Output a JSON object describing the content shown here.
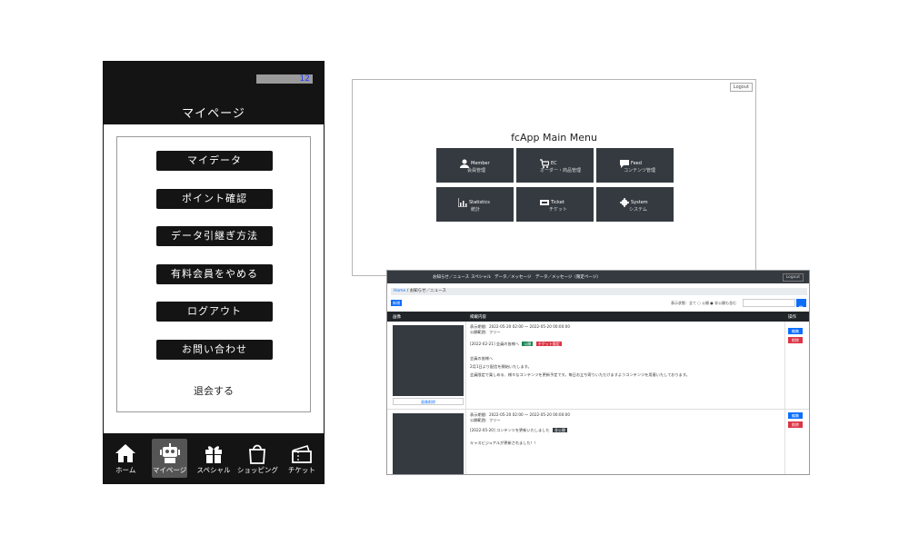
{
  "phone": {
    "badge": "12",
    "title": "マイページ",
    "menu": [
      "マイデータ",
      "ポイント確認",
      "データ引継ぎ方法",
      "有料会員をやめる",
      "ログアウト",
      "お問い合わせ"
    ],
    "withdraw": "退会する",
    "nav": [
      {
        "label": "ホーム",
        "icon": "home-icon"
      },
      {
        "label": "マイページ",
        "icon": "robot-icon",
        "active": true
      },
      {
        "label": "スペシャル",
        "icon": "gift-icon"
      },
      {
        "label": "ショッピング",
        "icon": "shopping-bag-icon"
      },
      {
        "label": "チケット",
        "icon": "ticket-icon"
      }
    ]
  },
  "admin": {
    "logout": "Logout",
    "title": "fcApp Main Menu",
    "tiles": [
      {
        "label": "Member",
        "sub": "会員管理",
        "icon": "user-icon"
      },
      {
        "label": "EC",
        "sub": "オーダー・商品管理",
        "icon": "cart-icon"
      },
      {
        "label": "Feed",
        "sub": "コンテンツ管理",
        "icon": "comment-icon"
      },
      {
        "label": "Statistics",
        "sub": "統計",
        "icon": "chart-icon"
      },
      {
        "label": "Ticket",
        "sub": "チケット",
        "icon": "ticket-icon"
      },
      {
        "label": "System",
        "sub": "システム",
        "icon": "gear-icon"
      }
    ]
  },
  "news": {
    "tabs": [
      "お知らせ／ニュース",
      "スペシャル",
      "データ／メッセージ",
      "データ／メッセージ（限定ページ）"
    ],
    "logout": "Logout",
    "breadcrumb": {
      "home": "Home",
      "current": "お知らせ／ニュース"
    },
    "new_button": "新規",
    "filter_text": "表示状態：全て ○ 公開 ● 非公開も含む",
    "columns": {
      "image": "画像",
      "content": "掲載内容",
      "action": "操作"
    },
    "rows": [
      {
        "thumb_caption": "画像削除",
        "period": "表示期間：2022-05-20 02:00 〜 2022-05-20 00:00:00",
        "target": "公開範囲：フリー",
        "headline": "[2022-02-21] 会員の皆様へ",
        "badges": [
          "公開",
          "チケット限定"
        ],
        "body1": "会員の皆様へ",
        "body2": "2月1日より配信を開始いたします。",
        "body3": "会員限定で楽しめる、様々なコンテンツを更新予定です。毎日お立ち寄りいただけますようコンテンツを用意いたしております。"
      },
      {
        "period": "表示期間：2022-05-20 02:00 〜 2022-05-20 00:00:00",
        "target": "公開範囲：フリー",
        "headline": "[2022-05-20] コンテンツを更新いたしました",
        "badges": [
          "非公開"
        ],
        "body1": "キャスビジュアルが更新されました！！"
      }
    ],
    "edit_label": "編集",
    "delete_label": "削除"
  }
}
